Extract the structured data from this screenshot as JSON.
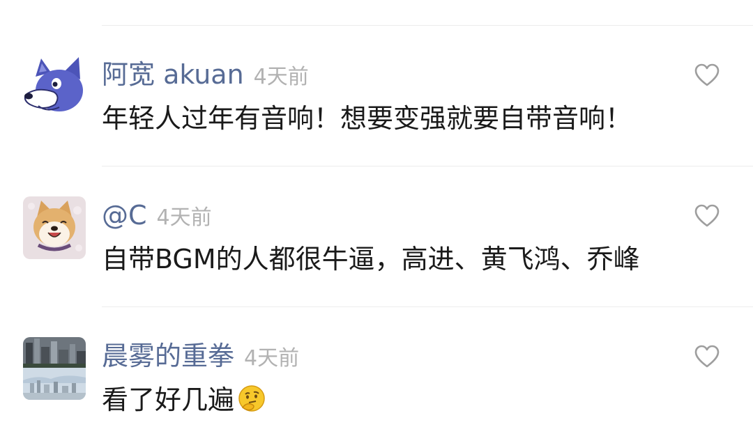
{
  "comments": [
    {
      "author": "阿宽 akuan",
      "time": "4天前",
      "text": "年轻人过年有音响！想要变强就要自带音响！",
      "avatar_icon": "cartoon-wolf-avatar",
      "like_icon": "heart-outline-icon"
    },
    {
      "author": "@C",
      "time": "4天前",
      "text": "自带BGM的人都很牛逼，高进、黄飞鸿、乔峰",
      "avatar_icon": "smiling-shiba-dog-avatar",
      "like_icon": "heart-outline-icon"
    },
    {
      "author": "晨雾的重拳",
      "time": "4天前",
      "text": "看了好几遍",
      "emoji": "thinking-face-emoji",
      "avatar_icon": "city-skyline-avatar",
      "like_icon": "heart-outline-icon"
    }
  ],
  "colors": {
    "author": "#576b95",
    "time": "#b2b2b2",
    "text": "#1a1a1a",
    "divider": "#ececec"
  }
}
